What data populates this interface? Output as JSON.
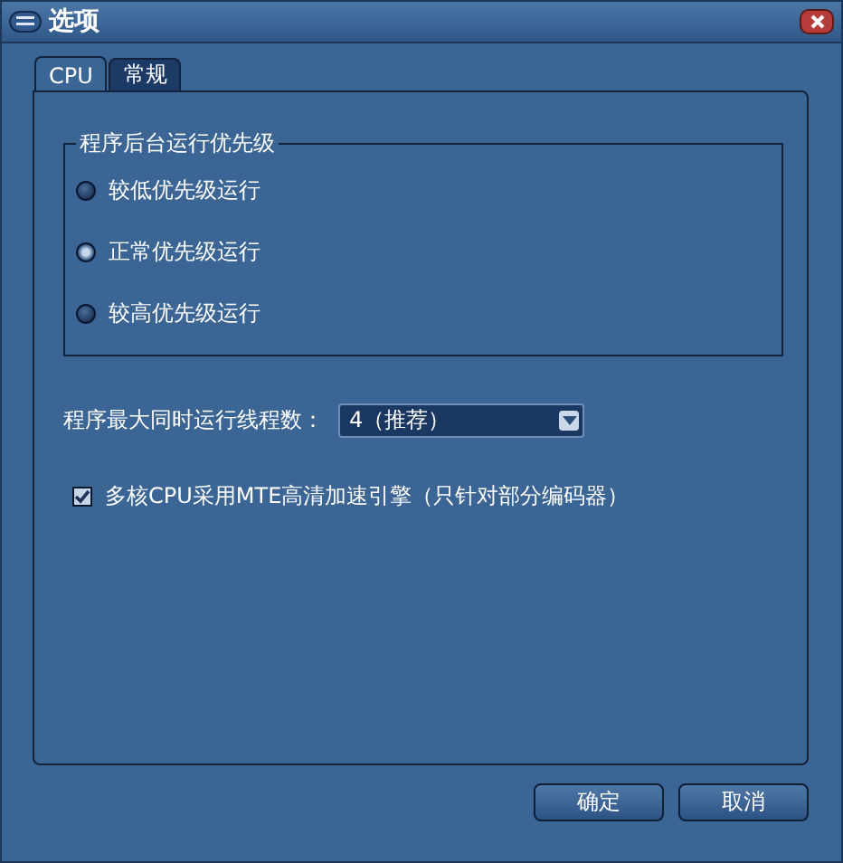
{
  "window": {
    "title": "选项"
  },
  "tabs": [
    {
      "label": "CPU",
      "selected": true
    },
    {
      "label": "常规",
      "selected": false
    }
  ],
  "priority_group": {
    "title": "程序后台运行优先级",
    "options": [
      {
        "label": "较低优先级运行",
        "selected": false
      },
      {
        "label": "正常优先级运行",
        "selected": true
      },
      {
        "label": "较高优先级运行",
        "selected": false
      }
    ]
  },
  "threads": {
    "label": "程序最大同时运行线程数：",
    "value": "4（推荐）"
  },
  "mte": {
    "label": "多核CPU采用MTE高清加速引擎（只针对部分编码器）",
    "checked": true
  },
  "buttons": [
    "确定",
    "取消"
  ]
}
